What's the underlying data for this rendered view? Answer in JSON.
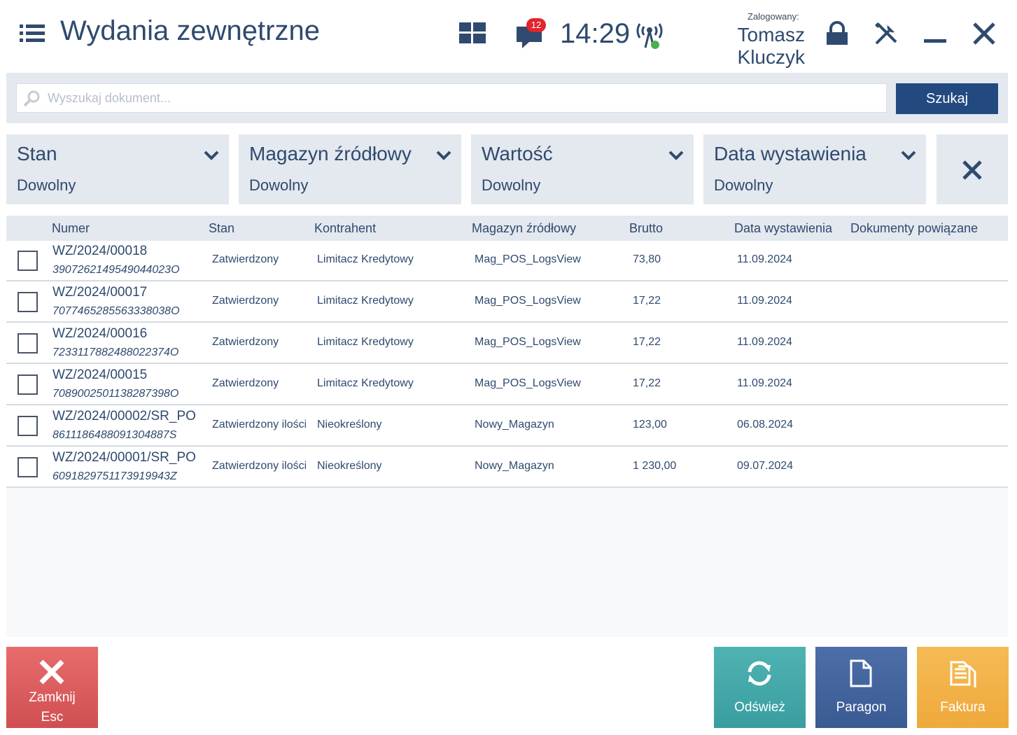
{
  "header": {
    "title": "Wydania zewnętrzne",
    "notification_count": "12",
    "clock": "14:29",
    "logged_label": "Zalogowany:",
    "user_name": "Tomasz Kluczyk"
  },
  "search": {
    "placeholder": "Wyszukaj dokument...",
    "value": "",
    "button_label": "Szukaj"
  },
  "filters": [
    {
      "title": "Stan",
      "value": "Dowolny"
    },
    {
      "title": "Magazyn źródłowy",
      "value": "Dowolny"
    },
    {
      "title": "Wartość",
      "value": "Dowolny"
    },
    {
      "title": "Data wystawienia",
      "value": "Dowolny"
    }
  ],
  "table": {
    "columns": [
      "Numer",
      "Stan",
      "Kontrahent",
      "Magazyn źródłowy",
      "Brutto",
      "Data wystawienia",
      "Dokumenty powiązane"
    ],
    "rows": [
      {
        "number": "WZ/2024/00018",
        "code": "3907262149549044023O",
        "state": "Zatwierdzony",
        "contractor": "Limitacz Kredytowy",
        "warehouse": "Mag_POS_LogsView",
        "gross": "73,80",
        "date": "11.09.2024",
        "related": ""
      },
      {
        "number": "WZ/2024/00017",
        "code": "7077465285563338038O",
        "state": "Zatwierdzony",
        "contractor": "Limitacz Kredytowy",
        "warehouse": "Mag_POS_LogsView",
        "gross": "17,22",
        "date": "11.09.2024",
        "related": ""
      },
      {
        "number": "WZ/2024/00016",
        "code": "7233117882488022374O",
        "state": "Zatwierdzony",
        "contractor": "Limitacz Kredytowy",
        "warehouse": "Mag_POS_LogsView",
        "gross": "17,22",
        "date": "11.09.2024",
        "related": ""
      },
      {
        "number": "WZ/2024/00015",
        "code": "7089002501138287398O",
        "state": "Zatwierdzony",
        "contractor": "Limitacz Kredytowy",
        "warehouse": "Mag_POS_LogsView",
        "gross": "17,22",
        "date": "11.09.2024",
        "related": ""
      },
      {
        "number": "WZ/2024/00002/SR_PO",
        "code": "8611186488091304887S",
        "state": "Zatwierdzony ilościowo",
        "contractor": "Nieokreślony",
        "warehouse": "Nowy_Magazyn",
        "gross": "123,00",
        "date": "06.08.2024",
        "related": ""
      },
      {
        "number": "WZ/2024/00001/SR_PO",
        "code": "6091829751173919943Z",
        "state": "Zatwierdzony ilościowo",
        "contractor": "Nieokreślony",
        "warehouse": "Nowy_Magazyn",
        "gross": "1 230,00",
        "date": "09.07.2024",
        "related": ""
      }
    ]
  },
  "footer": {
    "close_label": "Zamknij",
    "close_shortcut": "Esc",
    "refresh_label": "Odśwież",
    "receipt_label": "Paragon",
    "invoice_label": "Faktura"
  }
}
